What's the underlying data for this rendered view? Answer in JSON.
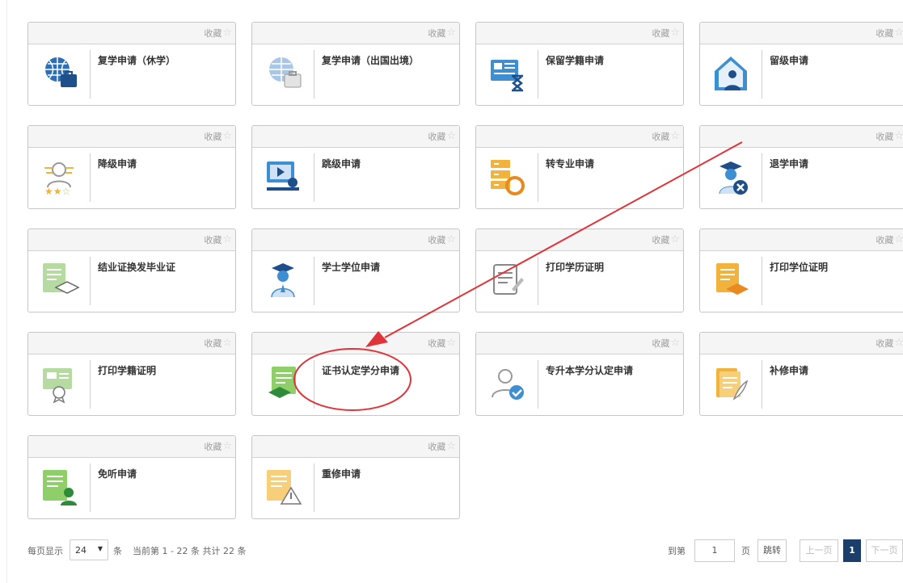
{
  "favorite_label": "收藏",
  "cards": [
    {
      "title": "复学申请（休学）",
      "icon": "globe-briefcase-icon"
    },
    {
      "title": "复学申请（出国出境）",
      "icon": "globe-briefcase-faded-icon"
    },
    {
      "title": "保留学籍申请",
      "icon": "id-card-hourglass-icon"
    },
    {
      "title": "留级申请",
      "icon": "house-person-icon"
    },
    {
      "title": "降级申请",
      "icon": "person-stars-icon"
    },
    {
      "title": "跳级申请",
      "icon": "monitor-play-icon"
    },
    {
      "title": "转专业申请",
      "icon": "server-refresh-icon"
    },
    {
      "title": "退学申请",
      "icon": "graduate-cancel-icon"
    },
    {
      "title": "结业证换发毕业证",
      "icon": "certificate-cap-icon"
    },
    {
      "title": "学士学位申请",
      "icon": "graduate-person-icon"
    },
    {
      "title": "打印学历证明",
      "icon": "document-pen-icon"
    },
    {
      "title": "打印学位证明",
      "icon": "document-cap-icon"
    },
    {
      "title": "打印学籍证明",
      "icon": "certificate-badge-icon"
    },
    {
      "title": "证书认定学分申请",
      "icon": "document-cap-green-icon"
    },
    {
      "title": "专升本学分认定申请",
      "icon": "person-check-icon"
    },
    {
      "title": "补修申请",
      "icon": "books-feather-icon"
    },
    {
      "title": "免听申请",
      "icon": "document-person-icon"
    },
    {
      "title": "重修申请",
      "icon": "document-warning-icon"
    }
  ],
  "pagination": {
    "per_page_label": "每页显示",
    "per_page_value": "24",
    "per_page_unit": "条",
    "current_info": "当前第 1 - 22 条 共计 22 条",
    "goto_label": "到第",
    "goto_value": "1",
    "page_unit": "页",
    "jump_label": "跳转",
    "prev_label": "上一页",
    "current_page": "1",
    "next_label": "下一页"
  }
}
